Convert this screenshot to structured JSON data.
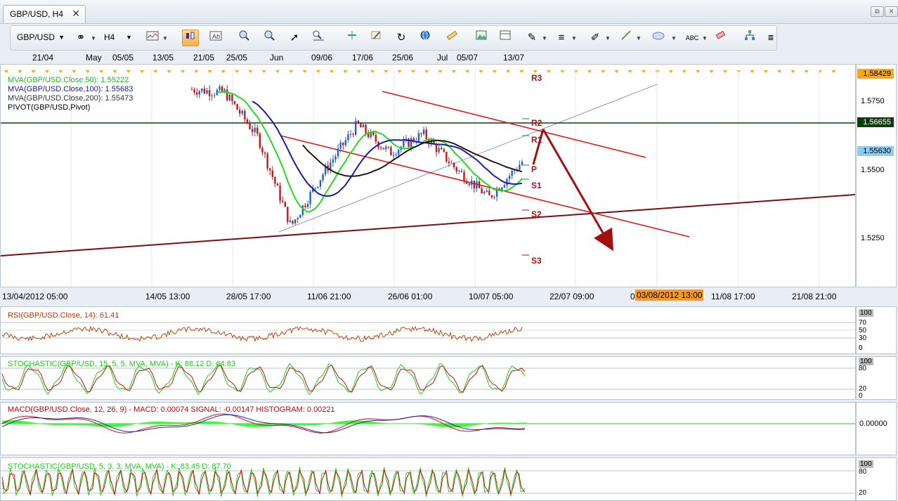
{
  "tab": {
    "title": "GBP/USD, H4",
    "close": "✕"
  },
  "window": {
    "restore": "⧉",
    "close": "✕"
  },
  "toolbar": {
    "symbol": "GBP/USD",
    "timeframe": "H4",
    "icons": [
      "link-icon",
      "bar-chart-icon",
      "candlestick-icon",
      "line-chart-icon",
      "zoom-in-icon",
      "zoom-out-icon",
      "cursor-icon",
      "zoom-window-icon",
      "hline-icon",
      "edit-icon",
      "refresh-icon",
      "globe-icon",
      "ruler-icon",
      "image-icon",
      "template-icon",
      "tools-icon",
      "studies-icon",
      "pen-icon",
      "line-icon",
      "ellipse-icon",
      "text-icon",
      "eraser-icon",
      "network-icon",
      "more-icon"
    ]
  },
  "date_axis": {
    "labels": [
      "21/04",
      "May",
      "05/05",
      "13/05",
      "21/05",
      "25/05",
      "Jun",
      "09/06",
      "17/06",
      "25/06",
      "Jul",
      "05/07",
      "13/07"
    ]
  },
  "time_axis": {
    "labels": [
      "13/04/2012 05:00",
      "14/05 13:00",
      "28/05 17:00",
      "11/06 21:00",
      "26/06 01:00",
      "10/07 05:00",
      "22/07 09:00",
      "0",
      "11/08 17:00",
      "21/08 21:00"
    ],
    "cursor_label": "03/08/2012 13:00"
  },
  "main_chart": {
    "legend": [
      {
        "text": "MVA(GBP/USD.Close,50): 1.55222",
        "color": "#22bb22"
      },
      {
        "text": "MVA(GBP/USD.Close,100): 1.55683",
        "color": "#1a1aa8"
      },
      {
        "text": "MVA(GBP/USD.Close,200): 1.55473",
        "color": "#333333"
      },
      {
        "text": "PIVOT(GBP/USD,Pivot)",
        "color": "#000000"
      }
    ],
    "pivot_labels": [
      "R3",
      "R2",
      "R1",
      "P",
      "S1",
      "S2",
      "S3"
    ],
    "price_ticks": [
      "1.5750",
      "1.5500",
      "1.5250"
    ],
    "price_tags": [
      {
        "label": "1.58429",
        "bg": "#f5a623",
        "color": "#000000"
      },
      {
        "label": "1.56655",
        "bg": "#0b3d0b",
        "color": "#ffffff"
      },
      {
        "label": "1.55630",
        "bg": "#8ecbf0",
        "color": "#000000"
      }
    ]
  },
  "chart_data": {
    "type": "candlestick",
    "symbol": "GBP/USD",
    "timeframe": "H4",
    "ylim": [
      1.517,
      1.585
    ],
    "approx_close_path": [
      {
        "x": "13/05",
        "y": 1.579
      },
      {
        "x": "21/05",
        "y": 1.578
      },
      {
        "x": "25/05",
        "y": 1.564
      },
      {
        "x": "Jun",
        "y": 1.536
      },
      {
        "x": "09/06",
        "y": 1.553
      },
      {
        "x": "17/06",
        "y": 1.568
      },
      {
        "x": "25/06",
        "y": 1.559
      },
      {
        "x": "Jul",
        "y": 1.565
      },
      {
        "x": "05/07",
        "y": 1.554
      },
      {
        "x": "13/07",
        "y": 1.545
      },
      {
        "x": "13/07",
        "y": 1.5563
      }
    ],
    "moving_averages": [
      {
        "name": "MVA(GBP/USD.Close,50)",
        "value": 1.55222
      },
      {
        "name": "MVA(GBP/USD.Close,100)",
        "value": 1.55683
      },
      {
        "name": "MVA(GBP/USD.Close,200)",
        "value": 1.55473
      }
    ],
    "horizontal_line": 1.56655,
    "last_price": 1.5563,
    "top_price": 1.58429
  },
  "indicators": [
    {
      "id": "rsi",
      "title": "RSI(GBP/USD.Close, 14): 61.41",
      "color": "#cc3300",
      "ticks": [
        "100",
        "70",
        "50",
        "30",
        "0"
      ]
    },
    {
      "id": "stoch1",
      "title": "STOCHASTIC(GBP/USD, 15, 5, 5, MVA, MVA) -  K: 88.12   D: 64.83",
      "color": "#22cc22",
      "ticks": [
        "100",
        "80",
        "20",
        "0"
      ]
    },
    {
      "id": "macd",
      "title": "MACD(GBP/USD.Close, 12, 26, 9) -  MACD: 0.00074   SIGNAL: -0.00147   HISTOGRAM: 0.00221",
      "color": "#cc0000",
      "ticks": [
        "0.00000"
      ]
    },
    {
      "id": "stoch2",
      "title": "STOCHASTIC(GBP/USD, 5, 3, 3, MVA, MVA) -  K: 83.45   D: 87.70",
      "color": "#22cc22",
      "ticks": [
        "100",
        "80",
        "20"
      ]
    }
  ]
}
